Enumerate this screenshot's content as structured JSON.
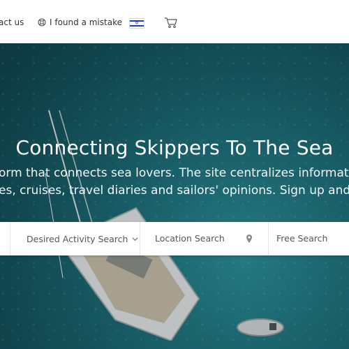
{
  "nav": {
    "contact_label": "act us",
    "mistake_label": "I found a mistake",
    "flag_icon": "israel-flag-icon",
    "cart_icon": "cart-icon"
  },
  "hero": {
    "title": "Connecting Skippers To The Sea",
    "description_line1": "orm that connects sea lovers. The site centralizes information on",
    "description_line2": "es, cruises, travel diaries and sailors' opinions. Sign up and stay co"
  },
  "search": {
    "activity_label": "Desired Activity Search",
    "location_label": "Location Search",
    "free_label": "Free Search",
    "chevron_icon": "chevron-down-icon",
    "pin_icon": "map-pin-icon"
  },
  "colors": {
    "sea": "#1d6d78",
    "flag_blue": "#1f3fbf",
    "text_dark": "#333333",
    "text_muted": "#555555"
  }
}
